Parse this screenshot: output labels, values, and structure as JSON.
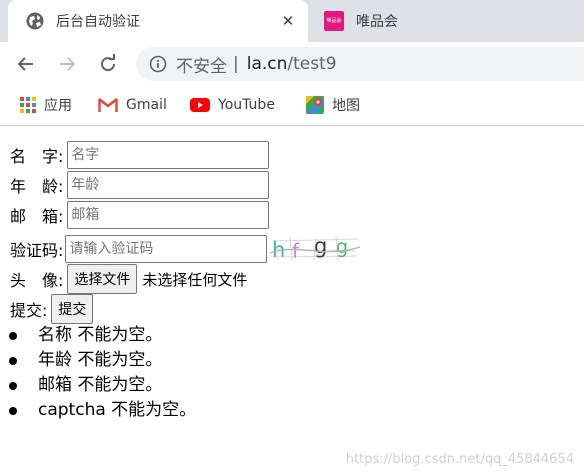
{
  "browser": {
    "tabs": [
      {
        "title": "后台自动验证",
        "active": true,
        "icon": "globe-icon"
      },
      {
        "title": "唯品会",
        "active": false,
        "icon": "vip-favicon",
        "icon_text": "唯品会"
      }
    ],
    "close_glyph": "✕",
    "address": {
      "insecure_label": "不安全",
      "separator": "|",
      "host": "la.cn",
      "path": "/test9"
    },
    "bookmarks": [
      {
        "label": "应用",
        "icon": "apps-grid-icon"
      },
      {
        "label": "Gmail",
        "icon": "gmail-icon"
      },
      {
        "label": "YouTube",
        "icon": "youtube-icon"
      },
      {
        "label": "地图",
        "icon": "maps-icon"
      }
    ]
  },
  "form": {
    "name": {
      "label": "名　字:",
      "placeholder": "名字",
      "value": ""
    },
    "age": {
      "label": "年　龄:",
      "placeholder": "年龄",
      "value": ""
    },
    "email": {
      "label": "邮　箱:",
      "placeholder": "邮箱",
      "value": ""
    },
    "captcha": {
      "label": "验证码:",
      "placeholder": "请输入验证码",
      "value": "",
      "image_text": "hfgg"
    },
    "avatar": {
      "label": "头　像:",
      "button": "选择文件",
      "status": "未选择任何文件"
    },
    "submit": {
      "label": "提交:",
      "button": "提交"
    }
  },
  "errors": [
    "名称 不能为空。",
    "年龄 不能为空。",
    "邮箱 不能为空。",
    "captcha 不能为空。"
  ],
  "watermark": "https://blog.csdn.net/qq_45844654",
  "colors": {
    "tabstrip": "#dee1e6",
    "omnibox": "#f1f3f4",
    "vip_brand": "#e2187c"
  }
}
